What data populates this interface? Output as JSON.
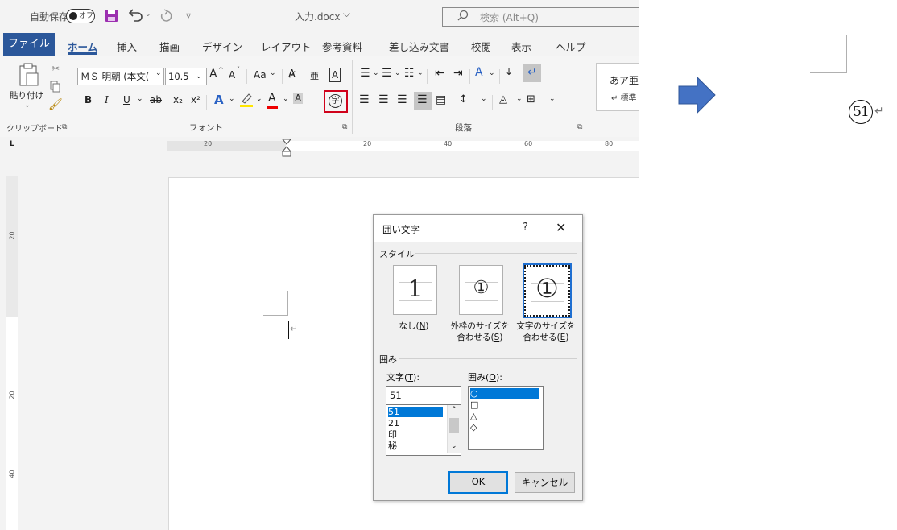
{
  "colors": {
    "accent": "#2b579a",
    "highlight_box": "#d0021b",
    "arrow": "#4472c4",
    "selection": "#0078d7"
  },
  "qat": {
    "autosave_label": "自動保存",
    "autosave_toggle": "オフ",
    "save_icon": "save-icon",
    "undo_icon": "undo-icon",
    "redo_icon": "redo-icon",
    "customize": "▿",
    "doc_title": "入力.docx",
    "title_chevron": "⌵"
  },
  "search": {
    "icon": "search-icon",
    "placeholder": "検索 (Alt+Q)"
  },
  "menu": {
    "file": "ファイル",
    "tabs": [
      "ホーム",
      "挿入",
      "描画",
      "デザイン",
      "レイアウト",
      "参考資料",
      "差し込み文書",
      "校閲",
      "表示",
      "ヘルプ"
    ]
  },
  "ribbon": {
    "clipboard": {
      "paste": "貼り付け",
      "group": "クリップボード"
    },
    "font": {
      "name": "ＭＳ 明朝 (本文(",
      "size": "10.5",
      "group": "フォント",
      "grow": "A",
      "shrink": "A",
      "case": "Aa",
      "phonetic": "亜",
      "border_char": "A",
      "bold": "B",
      "italic": "I",
      "underline": "U",
      "strike": "ab",
      "sub": "x₂",
      "sup": "x²",
      "shade_char": "A",
      "enclose": "字"
    },
    "paragraph": {
      "group": "段落"
    },
    "styles": {
      "sample": "あア亜",
      "standard": "↵ 標準"
    }
  },
  "ruler": {
    "h_labels": [
      "20",
      "20",
      "40",
      "60",
      "80"
    ],
    "corner": "L",
    "v_labels": [
      "20",
      "20",
      "40"
    ]
  },
  "dialog": {
    "title": "囲い文字",
    "help": "?",
    "close": "✕",
    "style_label": "スタイル",
    "styles": [
      {
        "glyph": "1",
        "caption_1": "なし(",
        "caption_key": "N",
        "caption_2": ")"
      },
      {
        "glyph": "①",
        "caption_1": "外枠のサイズを",
        "caption_line2": "合わせる(",
        "caption_key": "S",
        "caption_2": ")"
      },
      {
        "glyph": "①",
        "caption_1": "文字のサイズを",
        "caption_line2": "合わせる(",
        "caption_key": "E",
        "caption_2": ")"
      }
    ],
    "enclose_label": "囲み",
    "text_label": "文字(",
    "text_key": "T",
    "text_label_end": "):",
    "text_value": "51",
    "text_items": [
      "51",
      "21",
      "印",
      "秘"
    ],
    "shape_label": "囲み(",
    "shape_key": "O",
    "shape_label_end": "):",
    "shape_items": [
      "○",
      "□",
      "△",
      "◇"
    ],
    "ok": "OK",
    "cancel": "キャンセル"
  },
  "result": {
    "glyph": "51",
    "return_mark": "↵"
  }
}
